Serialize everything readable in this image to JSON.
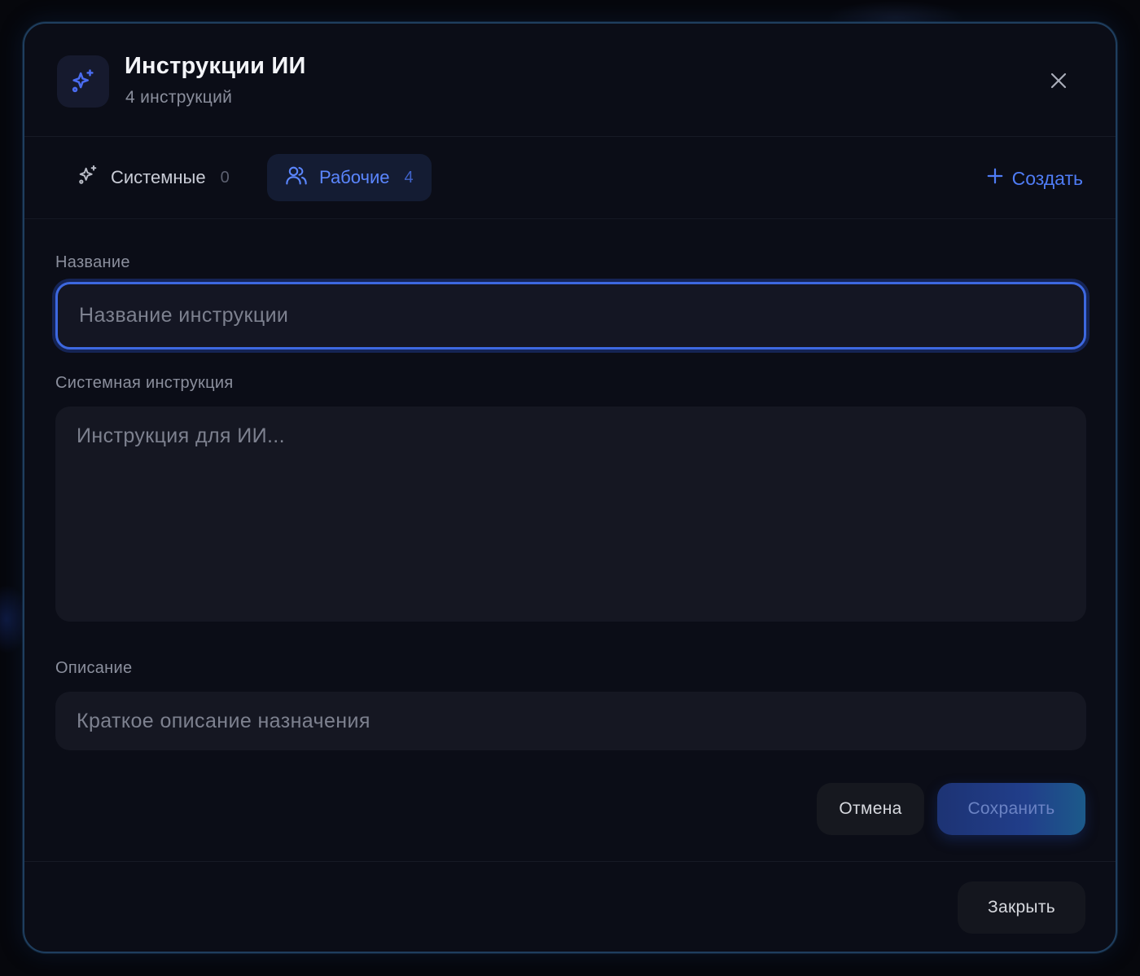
{
  "dialog": {
    "title": "Инструкции ИИ",
    "subtitle": "4 инструкций"
  },
  "tabs": [
    {
      "label": "Системные",
      "count": "0",
      "active": false
    },
    {
      "label": "Рабочие",
      "count": "4",
      "active": true
    }
  ],
  "create_label": "Создать",
  "form": {
    "name": {
      "label": "Название",
      "placeholder": "Название инструкции",
      "value": ""
    },
    "instruction": {
      "label": "Системная инструкция",
      "placeholder": "Инструкция для ИИ...",
      "value": ""
    },
    "description": {
      "label": "Описание",
      "placeholder": "Краткое описание назначения",
      "value": ""
    },
    "cancel_label": "Отмена",
    "save_label": "Сохранить"
  },
  "footer": {
    "close_label": "Закрыть"
  },
  "colors": {
    "accent": "#4f7cf5",
    "modal_bg": "#0b0d17",
    "input_bg": "#151722",
    "focus_ring": "#3d68e0"
  },
  "icons": {
    "header": "sparkles-icon",
    "close": "close-icon",
    "tab_system": "sparkles-icon",
    "tab_work": "users-icon",
    "create": "plus-icon"
  }
}
